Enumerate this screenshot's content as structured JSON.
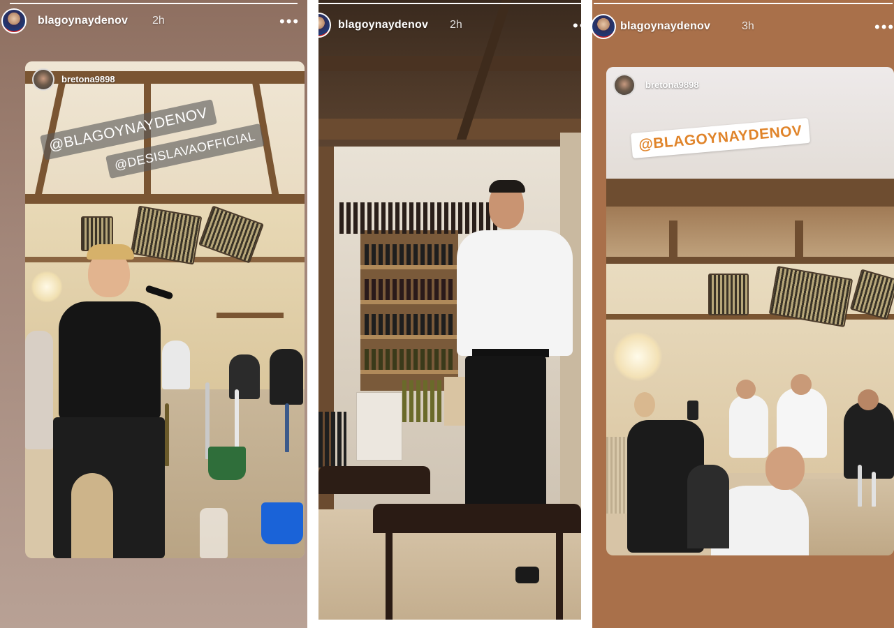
{
  "stories": [
    {
      "username": "blagoynaydenov",
      "time": "2h",
      "more_icon": "more-horizontal-icon",
      "reposted_from": "bretona9898",
      "mentions": [
        "@BLAGOYNAYDENOV",
        "@DESISLAVAOFFICIAL"
      ]
    },
    {
      "username": "blagoynaydenov",
      "time": "2h",
      "more_icon": "more-horizontal-icon"
    },
    {
      "username": "blagoynaydenov",
      "time": "3h",
      "more_icon": "more-horizontal-icon",
      "reposted_from": "bretona9898",
      "mentions": [
        "@BLAGOYNAYDENOV"
      ]
    }
  ],
  "colors": {
    "mention_accent": "#e0842a",
    "story3_background": "#a9704a"
  }
}
